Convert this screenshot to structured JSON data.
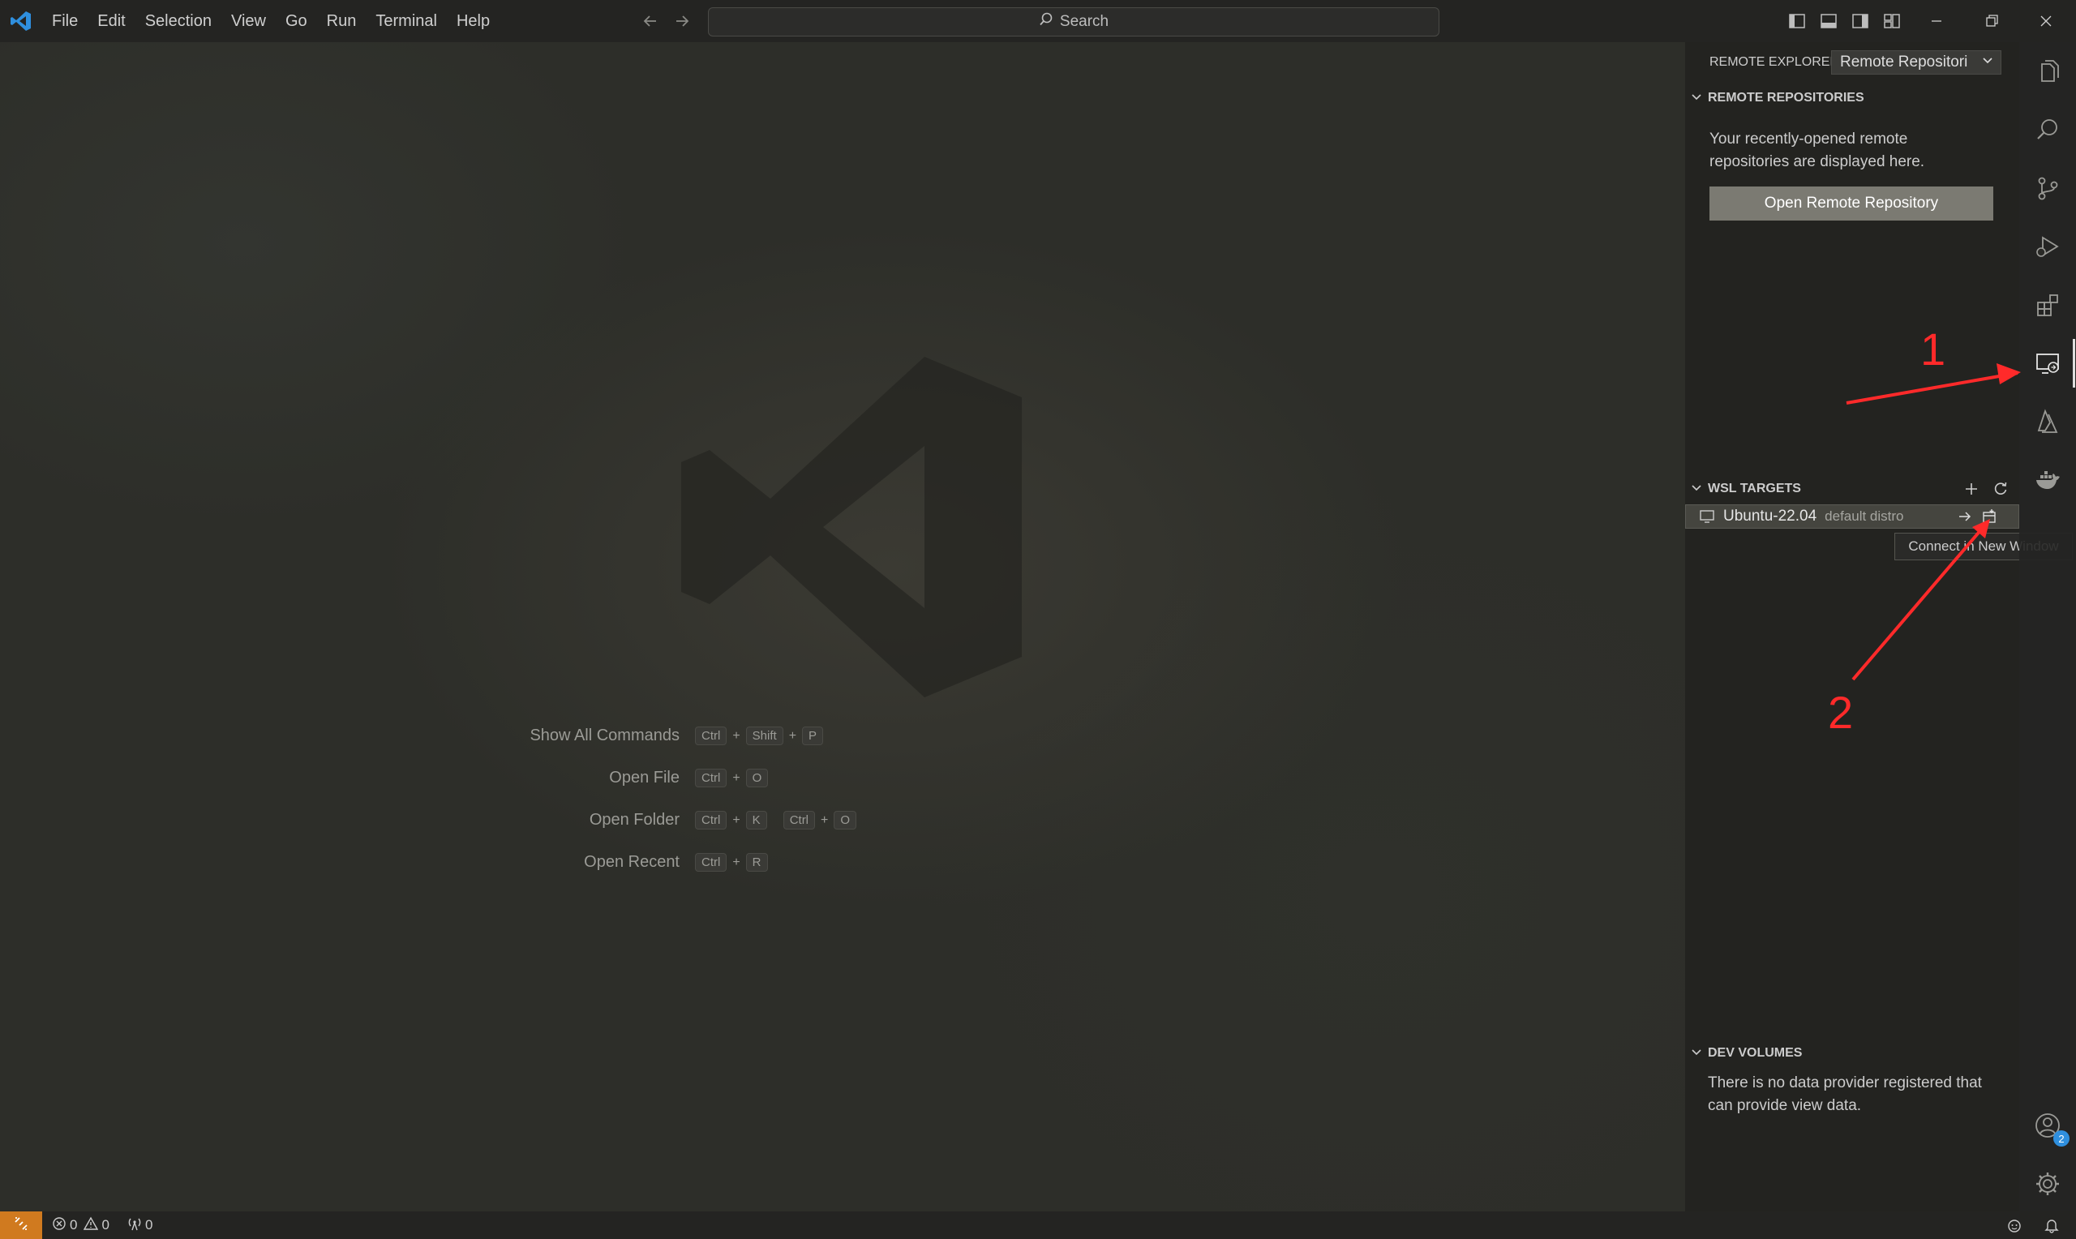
{
  "title_bar": {
    "menus": [
      "File",
      "Edit",
      "Selection",
      "View",
      "Go",
      "Run",
      "Terminal",
      "Help"
    ],
    "search_placeholder": "Search"
  },
  "editor": {
    "shortcuts": [
      {
        "label": "Show All Commands",
        "keys": [
          "Ctrl",
          "Shift",
          "P"
        ]
      },
      {
        "label": "Open File",
        "keys": [
          "Ctrl",
          "O"
        ]
      },
      {
        "label": "Open Folder",
        "keys": [
          "Ctrl",
          "K"
        ],
        "keys2": [
          "Ctrl",
          "O"
        ]
      },
      {
        "label": "Open Recent",
        "keys": [
          "Ctrl",
          "R"
        ]
      }
    ]
  },
  "sidebar": {
    "title": "REMOTE EXPLORER",
    "dropdown_value": "Remote Repositori",
    "remote_repos": {
      "header": "REMOTE REPOSITORIES",
      "description": "Your recently-opened remote repositories are displayed here.",
      "open_button": "Open Remote Repository"
    },
    "wsl": {
      "header": "WSL TARGETS",
      "distro_name": "Ubuntu-22.04",
      "distro_desc": "default distro",
      "tooltip": "Connect in New Window"
    },
    "dev_volumes": {
      "header": "DEV VOLUMES",
      "description": "There is no data provider registered that can provide view data."
    }
  },
  "activity_bar": {
    "accounts_badge": "2"
  },
  "status_bar": {
    "errors": "0",
    "warnings": "0",
    "ports": "0"
  },
  "annotations": {
    "label_1": "1",
    "label_2": "2"
  },
  "colors": {
    "accent_remote": "#d07a1f",
    "annotation_red": "#ff2a2a",
    "button_bg": "#7b7a72",
    "vscode_blue": "#2f8fde"
  }
}
